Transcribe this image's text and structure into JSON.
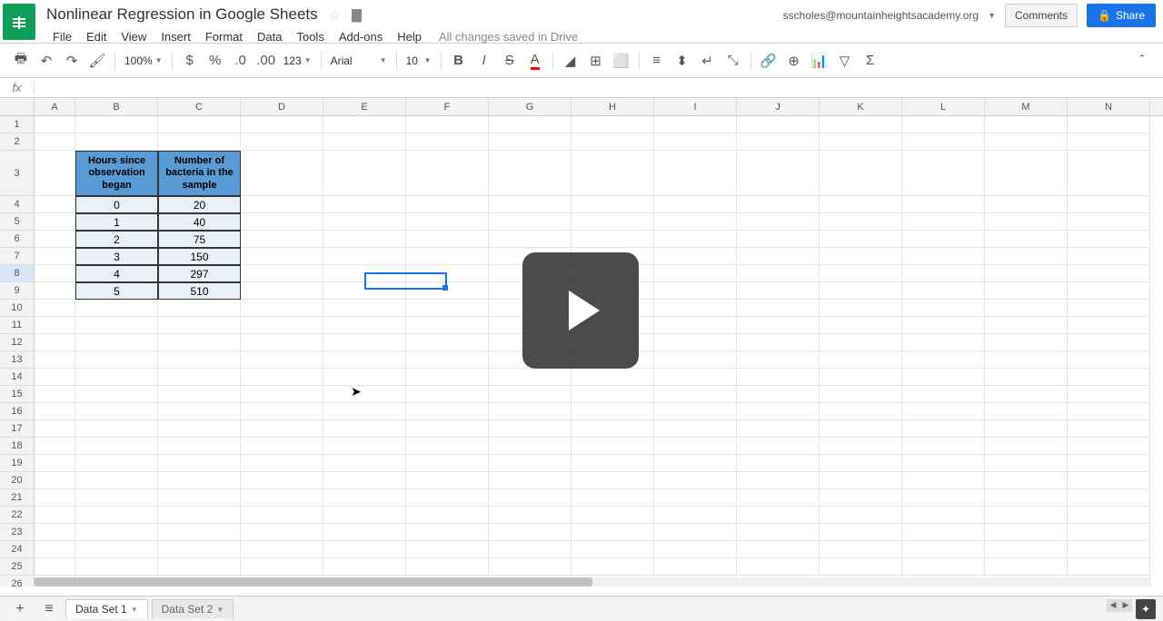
{
  "header": {
    "title": "Nonlinear Regression in Google Sheets",
    "user_email": "sscholes@mountainheightsacademy.org",
    "comments_label": "Comments",
    "share_label": "Share"
  },
  "menu": {
    "file": "File",
    "edit": "Edit",
    "view": "View",
    "insert": "Insert",
    "format": "Format",
    "data": "Data",
    "tools": "Tools",
    "addons": "Add-ons",
    "help": "Help",
    "save_status": "All changes saved in Drive"
  },
  "toolbar": {
    "zoom": "100%",
    "format_num": "123",
    "font": "Arial",
    "font_size": "10"
  },
  "formula_bar": {
    "fx": "fx",
    "value": ""
  },
  "columns": [
    "A",
    "B",
    "C",
    "D",
    "E",
    "F",
    "G",
    "H",
    "I",
    "J",
    "K",
    "L",
    "M",
    "N"
  ],
  "rows": [
    "1",
    "2",
    "3",
    "4",
    "5",
    "6",
    "7",
    "8",
    "9",
    "10",
    "11",
    "12",
    "13",
    "14",
    "15",
    "16",
    "17",
    "18",
    "19",
    "20",
    "21",
    "22",
    "23",
    "24",
    "25",
    "26"
  ],
  "table": {
    "header_b": "Hours since observation began",
    "header_c": "Number of bacteria in the sample",
    "data": [
      {
        "b": "0",
        "c": "20"
      },
      {
        "b": "1",
        "c": "40"
      },
      {
        "b": "2",
        "c": "75"
      },
      {
        "b": "3",
        "c": "150"
      },
      {
        "b": "4",
        "c": "297"
      },
      {
        "b": "5",
        "c": "510"
      }
    ]
  },
  "active_cell": {
    "col": "E",
    "row": "8"
  },
  "tabs": {
    "sheet1": "Data Set 1",
    "sheet2": "Data Set 2"
  }
}
